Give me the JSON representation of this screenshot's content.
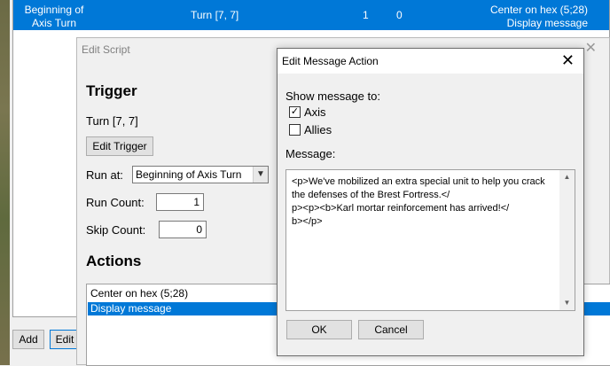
{
  "script_list": {
    "selected_row": {
      "event": "Beginning of Axis Turn",
      "trigger": "Turn [7, 7]",
      "run_count": "1",
      "skip_count": "0",
      "actions_line1": "Center on hex (5;28)",
      "actions_line2": "Display message"
    },
    "add_label": "Add",
    "edit_label": "Edit"
  },
  "edit_script": {
    "title": "Edit Script",
    "trigger_heading": "Trigger",
    "trigger_value": "Turn [7, 7]",
    "edit_trigger_label": "Edit Trigger",
    "run_at_label": "Run at:",
    "run_at_value": "Beginning of Axis Turn",
    "run_count_label": "Run Count:",
    "run_count_value": "1",
    "skip_count_label": "Skip Count:",
    "skip_count_value": "0",
    "actions_heading": "Actions",
    "actions": [
      "Center on hex (5;28)",
      "Display message"
    ]
  },
  "edit_message": {
    "title": "Edit Message Action",
    "show_to_label": "Show message to:",
    "axis_label": "Axis",
    "axis_checked": true,
    "allies_label": "Allies",
    "allies_checked": false,
    "message_label": "Message:",
    "message_text": "<p>We've mobilized an extra special unit to help you crack the defenses of the Brest Fortress.</\np><p><b>Karl mortar reinforcement has arrived!</\nb></p>",
    "ok_label": "OK",
    "cancel_label": "Cancel"
  },
  "colors": {
    "selection": "#0078d7",
    "dialog_bg": "#f0f0f0"
  },
  "icons": {
    "close": "close-icon",
    "dropdown": "chevron-down-icon",
    "check": "checkmark-icon"
  }
}
